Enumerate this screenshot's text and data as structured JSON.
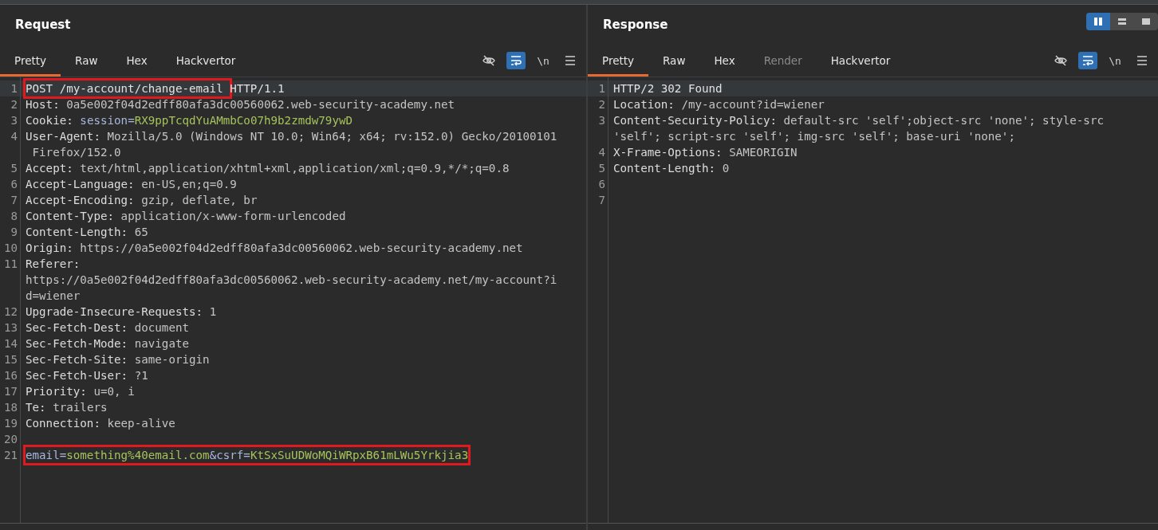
{
  "panels": [
    {
      "title": "Request",
      "tabs": [
        {
          "label": "Pretty",
          "selected": true,
          "disabled": false
        },
        {
          "label": "Raw",
          "selected": false,
          "disabled": false
        },
        {
          "label": "Hex",
          "selected": false,
          "disabled": false
        },
        {
          "label": "Hackvertor",
          "selected": false,
          "disabled": false
        }
      ],
      "tools": [
        {
          "kind": "hide",
          "active": false
        },
        {
          "kind": "wrap",
          "active": true
        },
        {
          "kind": "newline",
          "label": "\\n",
          "active": false
        },
        {
          "kind": "menu",
          "active": false
        }
      ],
      "lines": [
        {
          "number": "1",
          "current": true,
          "rows": [
            [
              {
                "kind": "plain",
                "text": "POST /my-account/change-email ",
                "boxed": true
              },
              {
                "kind": "plain",
                "text": "HTTP/1.1",
                "boxed": false
              }
            ]
          ]
        },
        {
          "number": "2",
          "current": false,
          "rows": [
            [
              {
                "kind": "key",
                "text": "Host: ",
                "boxed": false
              },
              {
                "kind": "value",
                "text": "0a5e002f04d2edff80afa3dc00560062.web-security-academy.net",
                "boxed": false
              }
            ]
          ]
        },
        {
          "number": "3",
          "current": false,
          "rows": [
            [
              {
                "kind": "key",
                "text": "Cookie: ",
                "boxed": false
              },
              {
                "kind": "param",
                "text": "session=",
                "boxed": false
              },
              {
                "kind": "paramvalue",
                "text": "RX9ppTcqdYuAMmbCo07h9b2zmdw79ywD",
                "boxed": false
              }
            ]
          ]
        },
        {
          "number": "4",
          "current": false,
          "rows": [
            [
              {
                "kind": "key",
                "text": "User-Agent: ",
                "boxed": false
              },
              {
                "kind": "value",
                "text": "Mozilla/5.0 (Windows NT 10.0; Win64; x64; rv:152.0) Gecko/20100101",
                "boxed": false
              }
            ],
            [
              {
                "kind": "value",
                "text": " Firefox/152.0",
                "boxed": false
              }
            ]
          ]
        },
        {
          "number": "5",
          "current": false,
          "rows": [
            [
              {
                "kind": "key",
                "text": "Accept: ",
                "boxed": false
              },
              {
                "kind": "value",
                "text": "text/html,application/xhtml+xml,application/xml;q=0.9,*/*;q=0.8",
                "boxed": false
              }
            ]
          ]
        },
        {
          "number": "6",
          "current": false,
          "rows": [
            [
              {
                "kind": "key",
                "text": "Accept-Language: ",
                "boxed": false
              },
              {
                "kind": "value",
                "text": "en-US,en;q=0.9",
                "boxed": false
              }
            ]
          ]
        },
        {
          "number": "7",
          "current": false,
          "rows": [
            [
              {
                "kind": "key",
                "text": "Accept-Encoding: ",
                "boxed": false
              },
              {
                "kind": "value",
                "text": "gzip, deflate, br",
                "boxed": false
              }
            ]
          ]
        },
        {
          "number": "8",
          "current": false,
          "rows": [
            [
              {
                "kind": "key",
                "text": "Content-Type: ",
                "boxed": false
              },
              {
                "kind": "value",
                "text": "application/x-www-form-urlencoded",
                "boxed": false
              }
            ]
          ]
        },
        {
          "number": "9",
          "current": false,
          "rows": [
            [
              {
                "kind": "key",
                "text": "Content-Length: ",
                "boxed": false
              },
              {
                "kind": "value",
                "text": "65",
                "boxed": false
              }
            ]
          ]
        },
        {
          "number": "10",
          "current": false,
          "rows": [
            [
              {
                "kind": "key",
                "text": "Origin: ",
                "boxed": false
              },
              {
                "kind": "value",
                "text": "https://0a5e002f04d2edff80afa3dc00560062.web-security-academy.net",
                "boxed": false
              }
            ]
          ]
        },
        {
          "number": "11",
          "current": false,
          "rows": [
            [
              {
                "kind": "key",
                "text": "Referer:",
                "boxed": false
              }
            ],
            [
              {
                "kind": "value",
                "text": "https://0a5e002f04d2edff80afa3dc00560062.web-security-academy.net/my-account?i",
                "boxed": false
              }
            ],
            [
              {
                "kind": "value",
                "text": "d=wiener",
                "boxed": false
              }
            ]
          ]
        },
        {
          "number": "12",
          "current": false,
          "rows": [
            [
              {
                "kind": "key",
                "text": "Upgrade-Insecure-Requests: ",
                "boxed": false
              },
              {
                "kind": "value",
                "text": "1",
                "boxed": false
              }
            ]
          ]
        },
        {
          "number": "13",
          "current": false,
          "rows": [
            [
              {
                "kind": "key",
                "text": "Sec-Fetch-Dest: ",
                "boxed": false
              },
              {
                "kind": "value",
                "text": "document",
                "boxed": false
              }
            ]
          ]
        },
        {
          "number": "14",
          "current": false,
          "rows": [
            [
              {
                "kind": "key",
                "text": "Sec-Fetch-Mode: ",
                "boxed": false
              },
              {
                "kind": "value",
                "text": "navigate",
                "boxed": false
              }
            ]
          ]
        },
        {
          "number": "15",
          "current": false,
          "rows": [
            [
              {
                "kind": "key",
                "text": "Sec-Fetch-Site: ",
                "boxed": false
              },
              {
                "kind": "value",
                "text": "same-origin",
                "boxed": false
              }
            ]
          ]
        },
        {
          "number": "16",
          "current": false,
          "rows": [
            [
              {
                "kind": "key",
                "text": "Sec-Fetch-User: ",
                "boxed": false
              },
              {
                "kind": "value",
                "text": "?1",
                "boxed": false
              }
            ]
          ]
        },
        {
          "number": "17",
          "current": false,
          "rows": [
            [
              {
                "kind": "key",
                "text": "Priority: ",
                "boxed": false
              },
              {
                "kind": "value",
                "text": "u=0, i",
                "boxed": false
              }
            ]
          ]
        },
        {
          "number": "18",
          "current": false,
          "rows": [
            [
              {
                "kind": "key",
                "text": "Te: ",
                "boxed": false
              },
              {
                "kind": "value",
                "text": "trailers",
                "boxed": false
              }
            ]
          ]
        },
        {
          "number": "19",
          "current": false,
          "rows": [
            [
              {
                "kind": "key",
                "text": "Connection: ",
                "boxed": false
              },
              {
                "kind": "value",
                "text": "keep-alive",
                "boxed": false
              }
            ]
          ]
        },
        {
          "number": "20",
          "current": false
        },
        {
          "number": "21",
          "current": false,
          "rows": [
            [
              {
                "kind": "param",
                "text": "email=",
                "boxed": true
              },
              {
                "kind": "paramvalue",
                "text": "something%40email.com",
                "boxed": true
              },
              {
                "kind": "param",
                "text": "&csrf=",
                "boxed": true
              },
              {
                "kind": "paramvalue",
                "text": "KtSxSuUDWoMQiWRpxB61mLWu5Yrkjia3",
                "boxed": true
              }
            ]
          ]
        }
      ]
    },
    {
      "title": "Response",
      "views": [
        {
          "kind": "split",
          "selected": true
        },
        {
          "kind": "rows",
          "selected": false
        },
        {
          "kind": "single",
          "selected": false
        }
      ],
      "tabs": [
        {
          "label": "Pretty",
          "selected": true,
          "disabled": false
        },
        {
          "label": "Raw",
          "selected": false,
          "disabled": false
        },
        {
          "label": "Hex",
          "selected": false,
          "disabled": false
        },
        {
          "label": "Render",
          "selected": false,
          "disabled": true
        },
        {
          "label": "Hackvertor",
          "selected": false,
          "disabled": false
        }
      ],
      "tools": [
        {
          "kind": "hide",
          "active": false
        },
        {
          "kind": "wrap",
          "active": true
        },
        {
          "kind": "newline",
          "label": "\\n",
          "active": false
        },
        {
          "kind": "menu",
          "active": false
        }
      ],
      "lines": [
        {
          "number": "1",
          "current": true,
          "rows": [
            [
              {
                "kind": "plain",
                "text": "HTTP/2 302 Found",
                "boxed": false
              }
            ]
          ]
        },
        {
          "number": "2",
          "current": false,
          "rows": [
            [
              {
                "kind": "key",
                "text": "Location: ",
                "boxed": false
              },
              {
                "kind": "value",
                "text": "/my-account?id=wiener",
                "boxed": false
              }
            ]
          ]
        },
        {
          "number": "3",
          "current": false,
          "rows": [
            [
              {
                "kind": "key",
                "text": "Content-Security-Policy: ",
                "boxed": false
              },
              {
                "kind": "value",
                "text": "default-src 'self';object-src 'none'; style-src",
                "boxed": false
              }
            ],
            [
              {
                "kind": "value",
                "text": "'self'; script-src 'self'; img-src 'self'; base-uri 'none';",
                "boxed": false
              }
            ]
          ]
        },
        {
          "number": "4",
          "current": false,
          "rows": [
            [
              {
                "kind": "key",
                "text": "X-Frame-Options: ",
                "boxed": false
              },
              {
                "kind": "value",
                "text": "SAMEORIGIN",
                "boxed": false
              }
            ]
          ]
        },
        {
          "number": "5",
          "current": false,
          "rows": [
            [
              {
                "kind": "key",
                "text": "Content-Length: ",
                "boxed": false
              },
              {
                "kind": "value",
                "text": "0",
                "boxed": false
              }
            ]
          ]
        },
        {
          "number": "6",
          "current": false
        },
        {
          "number": "7",
          "current": false
        }
      ]
    }
  ]
}
